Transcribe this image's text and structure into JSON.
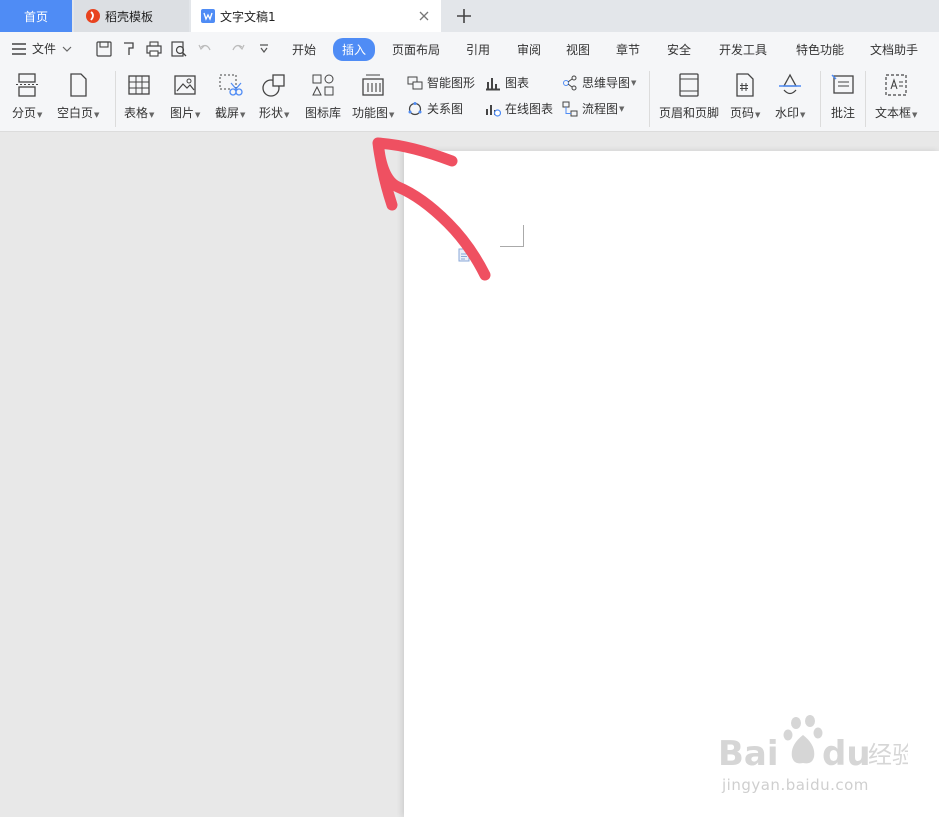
{
  "tabs": {
    "home": "首页",
    "daoke": "稻壳模板",
    "doc": "文字文稿1"
  },
  "menu": {
    "file": "文件",
    "items": [
      "开始",
      "插入",
      "页面布局",
      "引用",
      "审阅",
      "视图",
      "章节",
      "安全",
      "开发工具",
      "特色功能",
      "文档助手"
    ],
    "active": "插入"
  },
  "ribbon": {
    "fenye": "分页",
    "kongbaiye": "空白页",
    "biaoge": "表格",
    "tupian": "图片",
    "jieping": "截屏",
    "xingzhuang": "形状",
    "tubiaoku": "图标库",
    "gongnengtu": "功能图",
    "zhinengtuxing": "智能图形",
    "tubiao": "图表",
    "siweidaotu": "思维导图",
    "guanxitu": "关系图",
    "zaixiantubiao": "在线图表",
    "liuchengtu": "流程图",
    "yemeiheyejiao": "页眉和页脚",
    "yema": "页码",
    "shuiyin": "水印",
    "pizhu": "批注",
    "wenbenkuang": "文本框"
  },
  "watermark": {
    "brand": "Bai du 经验",
    "url": "jingyan.baidu.com"
  },
  "colors": {
    "accent": "#4f8cf5",
    "annotation": "#ef5061"
  }
}
